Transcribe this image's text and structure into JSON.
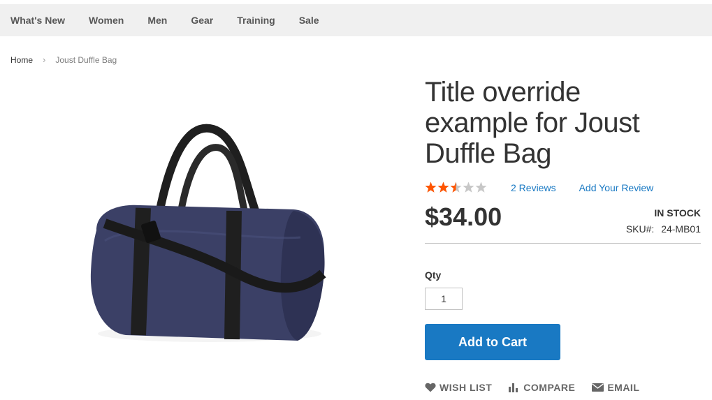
{
  "nav": {
    "items": [
      "What's New",
      "Women",
      "Men",
      "Gear",
      "Training",
      "Sale"
    ]
  },
  "breadcrumb": {
    "home": "Home",
    "separator": "›",
    "current": "Joust Duffle Bag"
  },
  "product": {
    "title_lines": [
      "Title override",
      "example for Joust",
      "Duffle Bag"
    ],
    "rating": {
      "value": 2.5,
      "max": 5,
      "filled_color": "#ff5501",
      "empty_color": "#c7c7c7"
    },
    "reviews_link": "2 Reviews",
    "add_review_link": "Add Your Review",
    "price": "$34.00",
    "stock": "IN STOCK",
    "sku_label": "SKU#:",
    "sku_value": "24-MB01",
    "qty_label": "Qty",
    "qty_value": "1",
    "add_to_cart": "Add to Cart"
  },
  "actions": [
    {
      "label": "WISH LIST",
      "icon": "heart-icon"
    },
    {
      "label": "COMPARE",
      "icon": "bar-chart-icon"
    },
    {
      "label": "EMAIL",
      "icon": "envelope-icon"
    }
  ],
  "colors": {
    "accent": "#1979c3",
    "nav_bg": "#f0f0f0",
    "bag_body": "#3b4066",
    "bag_strap": "#1f1f1f"
  }
}
